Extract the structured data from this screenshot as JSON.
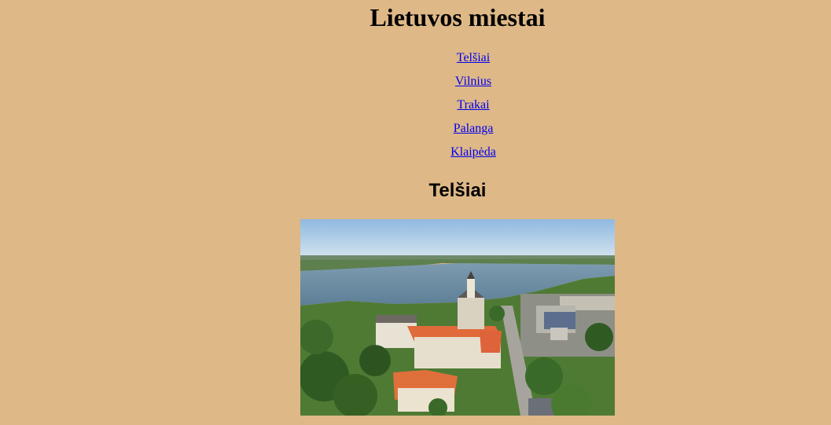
{
  "page": {
    "title": "Lietuvos miestai"
  },
  "nav": {
    "links": [
      {
        "label": "Telšiai"
      },
      {
        "label": "Vilnius"
      },
      {
        "label": "Trakai"
      },
      {
        "label": "Palanga"
      },
      {
        "label": "Klaipėda"
      }
    ]
  },
  "section": {
    "title": "Telšiai"
  },
  "colors": {
    "background": "#deb887",
    "link": "#0000ee"
  }
}
